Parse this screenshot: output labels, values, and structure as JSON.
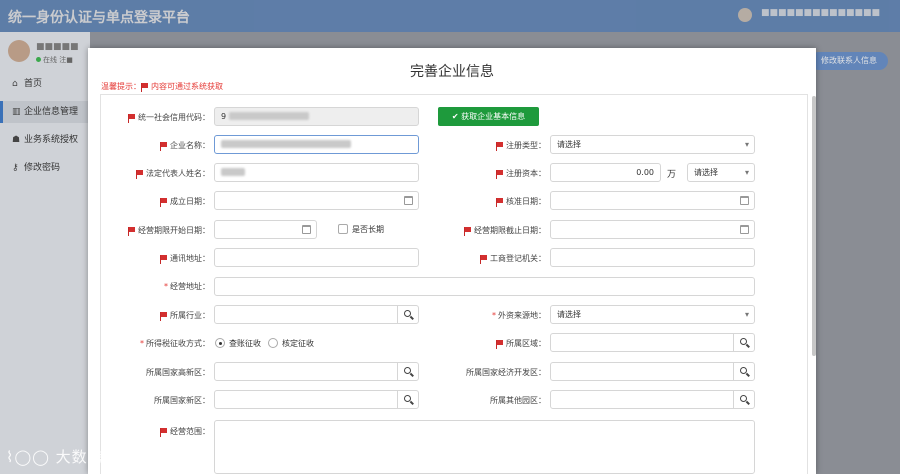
{
  "app": {
    "title": "统一身份认证与单点登录平台",
    "menu_icon": "hamburger-icon",
    "user_name": "■■■■■■■■■■■■■■"
  },
  "sidebar": {
    "user_name": "■■■■■",
    "status": "在线",
    "status2": "注■",
    "items": [
      {
        "label": "首页",
        "icon": "home-icon"
      },
      {
        "label": "企业信息管理",
        "icon": "bank-icon"
      },
      {
        "label": "业务系统授权",
        "icon": "users-icon"
      },
      {
        "label": "修改密码",
        "icon": "key-icon"
      }
    ]
  },
  "contact_button": "修改联系人信息",
  "modal": {
    "title": "完善企业信息",
    "hint_prefix": "温馨提示：",
    "hint_text": "内容可通过系统获取",
    "fetch_button": "获取企业基本信息",
    "fields": {
      "credit_code": "统一社会信用代码：",
      "company_name": "企业名称：",
      "reg_type": "注册类型：",
      "legal_rep": "法定代表人姓名：",
      "reg_capital": "注册资本：",
      "est_date": "成立日期：",
      "approve_date": "核准日期：",
      "op_start": "经营期限开始日期：",
      "long_term": "是否长期",
      "op_end": "经营期限截止日期：",
      "contact_addr": "通讯地址：",
      "reg_authority": "工商登记机关：",
      "op_addr": "经营地址：",
      "industry": "所属行业：",
      "foreign_src": "外资来源地：",
      "tax_method": "所得税征收方式：",
      "region": "所属区域：",
      "hightech_zone": "所属国家高新区：",
      "econ_zone": "所属国家经济开发区：",
      "new_zone": "所属国家新区：",
      "other_park": "所属其他园区：",
      "scope": "经营范围："
    },
    "values": {
      "credit_code": "9",
      "reg_type": "请选择",
      "reg_capital": "0.00",
      "capital_unit": "万",
      "currency": "请选择",
      "foreign_src": "请选择",
      "tax_opt1": "查账征收",
      "tax_opt2": "核定征收"
    }
  },
  "watermark": "大数跨境",
  "colors": {
    "accent": "#3a71b8",
    "required": "#e53935",
    "green": "#1e9a3c"
  }
}
